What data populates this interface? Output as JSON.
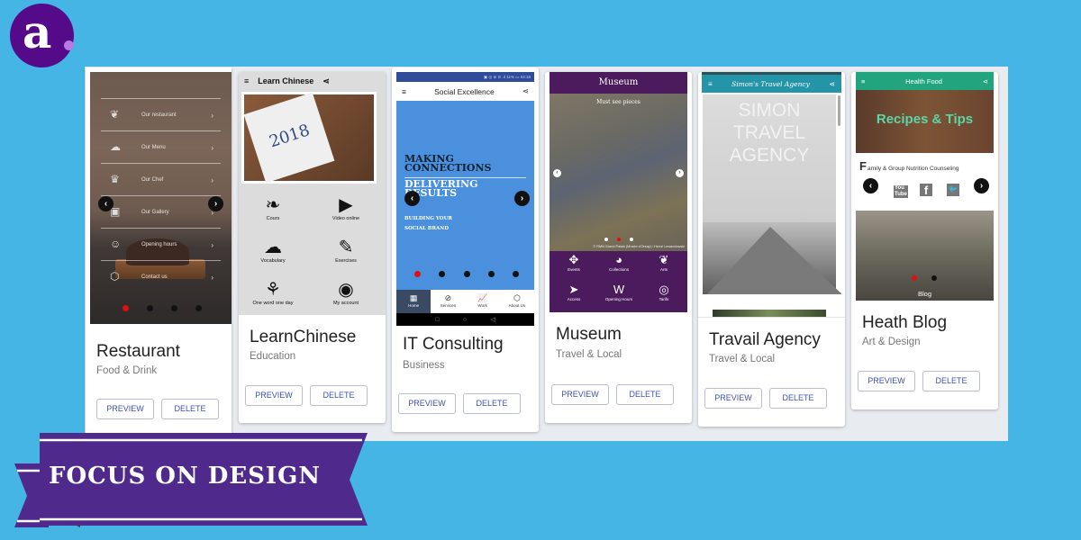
{
  "brand": {
    "logo_letter": "a",
    "banner_text": "FOCUS ON DESIGN",
    "colors": {
      "background": "#45b5e6",
      "logo": "#550a8a",
      "banner": "#4f2a8c",
      "button_text": "#3f51b5"
    }
  },
  "actions": {
    "preview": "PREVIEW",
    "delete": "DELETE"
  },
  "apps": [
    {
      "name": "Restaurant",
      "category": "Food & Drink",
      "screen": {
        "menu": [
          {
            "icon": "leaf-icon",
            "glyph": "❦",
            "label": "Our restaurant"
          },
          {
            "icon": "cloud-icon",
            "glyph": "☁",
            "label": "Our Menu"
          },
          {
            "icon": "trophy-icon",
            "glyph": "♛",
            "label": "Our Chef"
          },
          {
            "icon": "camera-icon",
            "glyph": "▣",
            "label": "Our Gallery"
          },
          {
            "icon": "smiley-icon",
            "glyph": "☺",
            "label": "Opening hours"
          },
          {
            "icon": "hexagon-icon",
            "glyph": "⬡",
            "label": "Contact us"
          }
        ],
        "chevron": "›",
        "slide_count": 4,
        "active_slide": 1
      }
    },
    {
      "name": "LearnChinese",
      "category": "Education",
      "screen": {
        "title": "Learn Chinese",
        "menu_glyph": "≡",
        "share_glyph": "⋖",
        "hero_text": "2018",
        "grid": [
          {
            "icon": "leaf-icon",
            "glyph": "❧",
            "label": "Cours"
          },
          {
            "icon": "youtube-icon",
            "glyph": "▶",
            "label": "Video online"
          },
          {
            "icon": "soundcloud-icon",
            "glyph": "☁",
            "label": "Vocabulary"
          },
          {
            "icon": "pencil-icon",
            "glyph": "✎",
            "label": "Exercises"
          },
          {
            "icon": "plant-icon",
            "glyph": "⚘",
            "label": "One word one day"
          },
          {
            "icon": "account-icon",
            "glyph": "◉",
            "label": "My account"
          }
        ]
      }
    },
    {
      "name": "IT Consulting",
      "category": "Business",
      "screen": {
        "status": "▣ ◎ ⊚ ≋ .ıl 11% ▭ 04:18",
        "title": "Social Excellence",
        "menu_glyph": "≡",
        "share_glyph": "⋖",
        "headline_1": "MAKING\nCONNECTIONS",
        "headline_2": "DELIVERING\nRESULTS",
        "tagline": "BUILDING YOUR\nSOCIAL BRAND",
        "slide_count": 5,
        "active_slide": 1,
        "tabs": [
          {
            "icon": "grid-icon",
            "glyph": "▦",
            "label": "Home",
            "active": true
          },
          {
            "icon": "services-icon",
            "glyph": "⊘",
            "label": "Services"
          },
          {
            "icon": "chart-icon",
            "glyph": "📈",
            "label": "Work"
          },
          {
            "icon": "hexagon-icon",
            "glyph": "⬡",
            "label": "About Us"
          }
        ],
        "system_nav": [
          "□",
          "○",
          "◁"
        ]
      }
    },
    {
      "name": "Museum",
      "category": "Travel & Local",
      "screen": {
        "title": "Museum",
        "caption": "Must see pieces",
        "credit": "© RMN Grand Palais (Musée d'Orsay) / Hervé Lewandowski",
        "slide_count": 3,
        "active_slide": 2,
        "grid": [
          {
            "icon": "events-icon",
            "glyph": "✥",
            "label": "Events"
          },
          {
            "icon": "collections-icon",
            "glyph": "◕",
            "label": "Collections"
          },
          {
            "icon": "arts-icon",
            "glyph": "❦",
            "label": "Arts"
          },
          {
            "icon": "access-icon",
            "glyph": "➤",
            "label": "Access"
          },
          {
            "icon": "opening-hours-icon",
            "glyph": "W",
            "label": "Opening Hours"
          },
          {
            "icon": "tariffs-icon",
            "glyph": "◎",
            "label": "Tarifs"
          }
        ]
      }
    },
    {
      "name": "Travail Agency",
      "category": "Travel & Local",
      "screen": {
        "title": "Simon's Travel Agency",
        "hero_text": "SIMON\nTRAVEL\nAGENCY",
        "menu_glyph": "≡",
        "share_glyph": "⋖"
      }
    },
    {
      "name": "Heath Blog",
      "category": "Art & Design",
      "screen": {
        "title": "Health Food",
        "menu_glyph": "≡",
        "share_glyph": "⋖",
        "hero_text": "Recipes & Tips",
        "subtitle_initial": "F",
        "subtitle": "amily & Group Nutrition Counseling",
        "social": [
          {
            "icon": "youtube-icon",
            "glyph": "You\nTube"
          },
          {
            "icon": "facebook-icon",
            "glyph": "f"
          },
          {
            "icon": "twitter-icon",
            "glyph": "🐦"
          }
        ],
        "blog_label": "Blog"
      }
    }
  ]
}
